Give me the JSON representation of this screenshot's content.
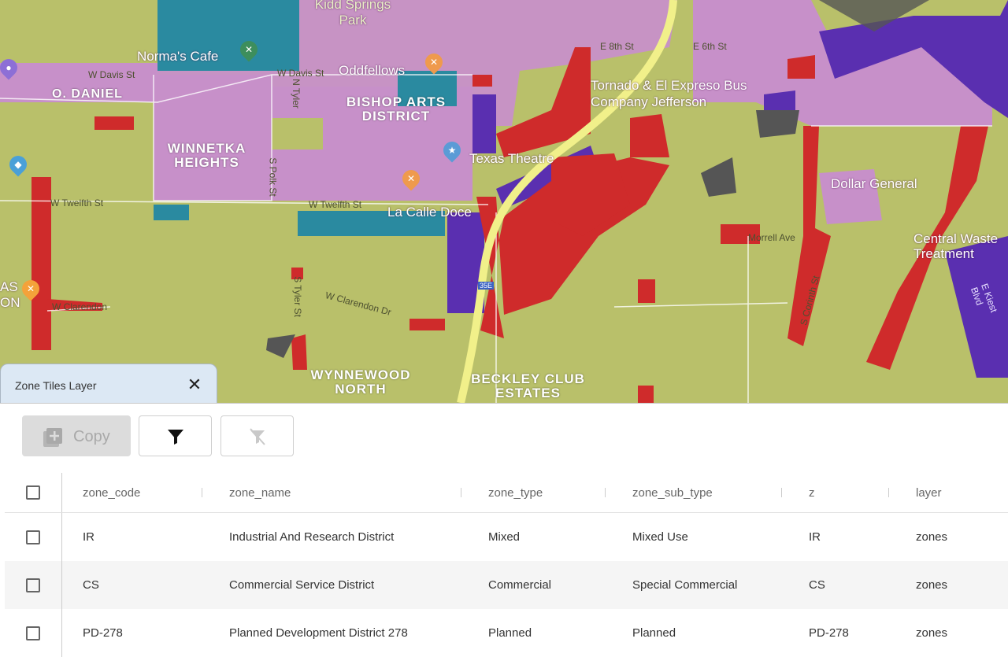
{
  "map": {
    "labels": {
      "o_daniel": "O. DANIEL",
      "winnetka_heights": "WINNETKA HEIGHTS",
      "bishop_arts_district": "BISHOP ARTS DISTRICT",
      "wynnewood_north": "WYNNEWOOD NORTH",
      "beckley_club_estates": "BECKLEY CLUB ESTATES"
    },
    "places": {
      "kidd_springs_park": "Kidd Springs Park",
      "normas_cafe": "Norma's Cafe",
      "oddfellows": "Oddfellows",
      "tornado_bus": "Tornado & El Expreso Bus Company Jefferson",
      "texas_theatre": "Texas Theatre",
      "la_calle_doce": "La Calle Doce",
      "dollar_general": "Dollar General",
      "central_waste": "Central Waste Treatment",
      "as_on": "AS ON"
    },
    "streets": {
      "w_davis_st_west": "W Davis St",
      "w_davis_st": "W Davis St",
      "w_twelfth_st_west": "W Twelfth St",
      "w_twelfth_st": "W Twelfth St",
      "e_8th_st": "E 8th St",
      "e_6th_st": "E 6th St",
      "w_clarendon_dr": "W Clarendon Dr",
      "w_clarendon": "W Clarendon",
      "morrell_ave": "Morrell Ave",
      "s_tyler_st": "S Tyler St",
      "n_tyler_st": "N Tyler",
      "s_polk_st": "S Polk St",
      "e_kiest_blvd": "E Kiest Blvd",
      "s_corinth_st": "S Corinth St",
      "i35e": "35E"
    },
    "colors": {
      "mixed": "#b9c06a",
      "residential_pink": "#c790c9",
      "teal": "#2a8aa0",
      "commercial_red": "#cf2b2b",
      "purple": "#5a2fb0",
      "dark_gray": "#555555"
    }
  },
  "tab": {
    "title": "Zone Tiles Layer",
    "close_icon": "close-icon"
  },
  "toolbar": {
    "copy_label": "Copy",
    "copy_icon": "library-add-icon",
    "filter_icon": "filter-icon",
    "clear_filter_icon": "filter-off-icon"
  },
  "table": {
    "columns": [
      "zone_code",
      "zone_name",
      "zone_type",
      "zone_sub_type",
      "z",
      "layer"
    ],
    "rows": [
      [
        "IR",
        "Industrial And Research District",
        "Mixed",
        "Mixed Use",
        "IR",
        "zones"
      ],
      [
        "CS",
        "Commercial Service District",
        "Commercial",
        "Special Commercial",
        "CS",
        "zones"
      ],
      [
        "PD-278",
        "Planned Development District 278",
        "Planned",
        "Planned",
        "PD-278",
        "zones"
      ]
    ]
  }
}
